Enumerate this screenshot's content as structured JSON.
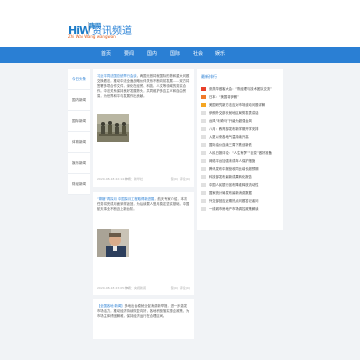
{
  "header": {
    "logo_text": "HiW",
    "logo_cn": "嗨网",
    "logo_sub": "Zhi Wai Wang wangwan",
    "site_title": "资讯频道"
  },
  "nav": {
    "items": [
      "首页",
      "要闻",
      "国内",
      "国际",
      "社会",
      "娱乐"
    ]
  },
  "sidebar": {
    "items": [
      "今日头条",
      "国内新闻",
      "国际新闻",
      "体育新闻",
      "娱乐新闻",
      "财经新闻"
    ]
  },
  "feed": {
    "cards": [
      {
        "highlight": "习近平同法国总统举行会谈",
        "body": "，两国元首将就国际形势和重大问题交换看法，推动中法全面战略伙伴关系不断向前发展……双方将签署多项合作文件，深化在经贸、科技、人文等领域的务实合作。中法关系保持良好发展势头，共同维护多边主义和自由贸易，为世界和平与发展作出贡献。",
        "date": "2020-08-18 22:14:07",
        "author": "作者：新华社",
        "like": "赞(0)",
        "comment": "评论(0)"
      },
      {
        "highlight": "“嫦娥”再探月 中国探月工程取得新进展",
        "body": "，航天专家介绍，本次任务将完成月面采样返回，为后续载人登月奠定坚实基础，中国航天事业不断迈上新台阶。",
        "date": "2020-08-18 23:05:36",
        "author": "作者：央视新闻",
        "like": "赞(0)",
        "comment": "评论(0)"
      },
      {
        "highlight": "【全国各地·新闻】",
        "body": "多地出台稳就业促消费新举措，进一步激发市场活力，推动经济持续恢复向好，各地积极落实惠企政策，为市场主体纾困解难，保持经济运行在合理区间。",
        "date": "",
        "author": "",
        "like": "",
        "comment": ""
      }
    ]
  },
  "hot": {
    "title": "最新排行",
    "items": [
      "张燕华做客大会：“陈经理与技术团队交流”",
      "日本：“美国将伊朗”",
      "美国研究新方法应对市场波动问题详解",
      "伊朗外交部长就地区局势发表讲话",
      "台风“利奇马”升级为超强台风",
      "八月：教育部发布新学期开学安排",
      "入夏以来各地气温持续升高",
      "国际油价连续三周下跌创新低",
      "人民日报评论：“人生有梦”“巨变”做好准备",
      "网络平台加强未成年人保护措施",
      "腾讯发布中报营收同比增长超预期",
      "科技部发布最新成果转化报告",
      "中国人民银行宣布降准释放流动性",
      "国家统计局发布最新消费数据",
      "外交部回应近期热点问题答记者问",
      "一线城市房地产市场调控政策解读"
    ]
  },
  "colors": {
    "nav_bg": "#2a7fd4",
    "link": "#2a7fd4",
    "rank1": "#e9402b",
    "rank2": "#f07a2a",
    "rank3": "#f5a623"
  }
}
